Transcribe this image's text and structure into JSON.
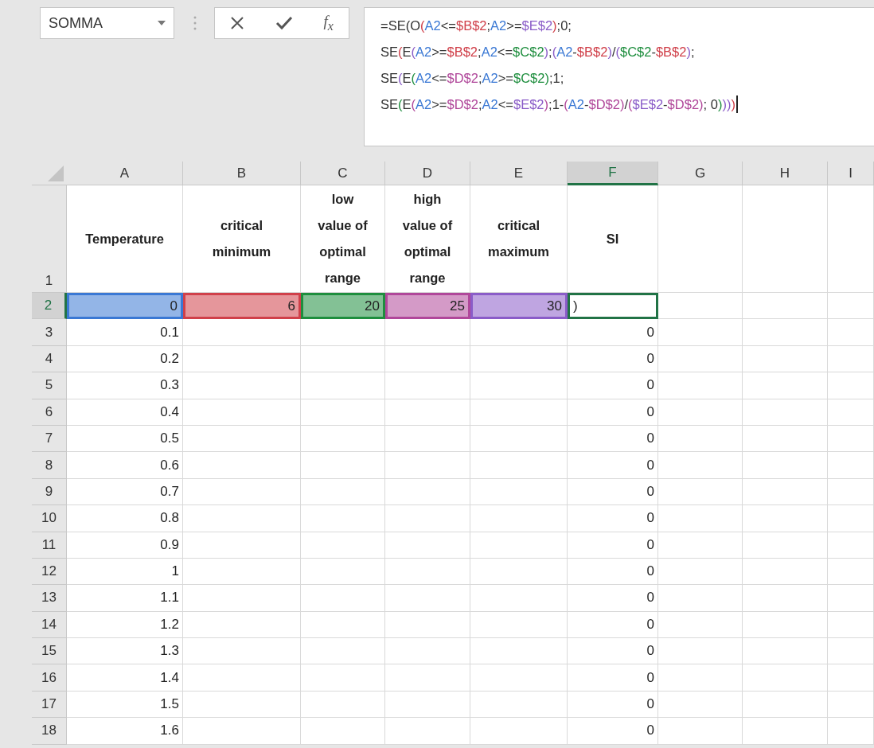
{
  "name_box": {
    "value": "SOMMA"
  },
  "formula_bar": {
    "function_label": "f$_{x}$",
    "lines": [
      {
        "caret": false,
        "segments": [
          {
            "text": "=SE(O"
          },
          {
            "text": "(",
            "color": "#d0404a"
          },
          {
            "text": "A2",
            "color": "#3a78d4"
          },
          {
            "text": "<="
          },
          {
            "text": "$B$2",
            "color": "#d0404a"
          },
          {
            "text": ";"
          },
          {
            "text": "A2",
            "color": "#3a78d4"
          },
          {
            "text": ">="
          },
          {
            "text": "$E$2",
            "color": "#8a5cc8"
          },
          {
            "text": ")",
            "color": "#d0404a"
          },
          {
            "text": ";0;"
          }
        ]
      },
      {
        "caret": false,
        "segments": [
          {
            "text": "SE"
          },
          {
            "text": "(",
            "color": "#d0404a"
          },
          {
            "text": "E"
          },
          {
            "text": "(",
            "color": "#8a5cc8"
          },
          {
            "text": "A2",
            "color": "#3a78d4"
          },
          {
            "text": ">="
          },
          {
            "text": "$B$2",
            "color": "#d0404a"
          },
          {
            "text": ";"
          },
          {
            "text": "A2",
            "color": "#3a78d4"
          },
          {
            "text": "<="
          },
          {
            "text": "$C$2",
            "color": "#1e8e3e"
          },
          {
            "text": ")",
            "color": "#8a5cc8"
          },
          {
            "text": ";"
          },
          {
            "text": "(",
            "color": "#8a5cc8"
          },
          {
            "text": "A2",
            "color": "#3a78d4"
          },
          {
            "text": "-"
          },
          {
            "text": "$B$2",
            "color": "#d0404a"
          },
          {
            "text": ")",
            "color": "#8a5cc8"
          },
          {
            "text": "/"
          },
          {
            "text": "(",
            "color": "#8a5cc8"
          },
          {
            "text": "$C$2",
            "color": "#1e8e3e"
          },
          {
            "text": "-"
          },
          {
            "text": "$B$2",
            "color": "#d0404a"
          },
          {
            "text": ")",
            "color": "#8a5cc8"
          },
          {
            "text": ";"
          }
        ]
      },
      {
        "caret": false,
        "segments": [
          {
            "text": "SE"
          },
          {
            "text": "(",
            "color": "#8a5cc8"
          },
          {
            "text": "E"
          },
          {
            "text": "(",
            "color": "#1e8e3e"
          },
          {
            "text": "A2",
            "color": "#3a78d4"
          },
          {
            "text": "<="
          },
          {
            "text": "$D$2",
            "color": "#b0479a"
          },
          {
            "text": ";"
          },
          {
            "text": "A2",
            "color": "#3a78d4"
          },
          {
            "text": ">="
          },
          {
            "text": "$C$2",
            "color": "#1e8e3e"
          },
          {
            "text": ")",
            "color": "#1e8e3e"
          },
          {
            "text": ";1;"
          }
        ]
      },
      {
        "caret": true,
        "segments": [
          {
            "text": "SE"
          },
          {
            "text": "(",
            "color": "#1e8e3e"
          },
          {
            "text": "E"
          },
          {
            "text": "(",
            "color": "#b0479a"
          },
          {
            "text": "A2",
            "color": "#3a78d4"
          },
          {
            "text": ">="
          },
          {
            "text": "$D$2",
            "color": "#b0479a"
          },
          {
            "text": ";"
          },
          {
            "text": "A2",
            "color": "#3a78d4"
          },
          {
            "text": "<="
          },
          {
            "text": "$E$2",
            "color": "#8a5cc8"
          },
          {
            "text": ")",
            "color": "#b0479a"
          },
          {
            "text": ";1-"
          },
          {
            "text": "(",
            "color": "#b0479a"
          },
          {
            "text": "A2",
            "color": "#3a78d4"
          },
          {
            "text": "-"
          },
          {
            "text": "$D$2",
            "color": "#b0479a"
          },
          {
            "text": ")",
            "color": "#b0479a"
          },
          {
            "text": "/"
          },
          {
            "text": "(",
            "color": "#b0479a"
          },
          {
            "text": "$E$2",
            "color": "#8a5cc8"
          },
          {
            "text": "-"
          },
          {
            "text": "$D$2",
            "color": "#b0479a"
          },
          {
            "text": ")",
            "color": "#b0479a"
          },
          {
            "text": "; 0"
          },
          {
            "text": ")",
            "color": "#1e8e3e"
          },
          {
            "text": ")",
            "color": "#8a5cc8"
          },
          {
            "text": ")",
            "color": "#8a5cc8"
          },
          {
            "text": ")",
            "color": "#d0404a"
          }
        ]
      }
    ]
  },
  "columns": [
    {
      "label": "A",
      "selected": false
    },
    {
      "label": "B",
      "selected": false
    },
    {
      "label": "C",
      "selected": false
    },
    {
      "label": "D",
      "selected": false
    },
    {
      "label": "E",
      "selected": false
    },
    {
      "label": "F",
      "selected": true
    },
    {
      "label": "G",
      "selected": false
    },
    {
      "label": "H",
      "selected": false
    },
    {
      "label": "I",
      "selected": false
    }
  ],
  "header_row": {
    "number": "1",
    "selected": false,
    "cells": [
      "Temperature",
      "critical minimum",
      "low value of optimal range",
      "high value of optimal range",
      "critical maximum",
      "SI"
    ]
  },
  "input_row": {
    "number": "2",
    "selected": true,
    "cells": [
      {
        "value": "0",
        "color": "#3a78d4",
        "selected": false
      },
      {
        "value": "6",
        "color": "#d0404a",
        "selected": false
      },
      {
        "value": "20",
        "color": "#1e8e3e",
        "selected": false
      },
      {
        "value": "25",
        "color": "#b0479a",
        "selected": false
      },
      {
        "value": "30",
        "color": "#8a5cc8",
        "selected": false
      },
      {
        "value": ")",
        "selected": true
      }
    ]
  },
  "rows": [
    {
      "number": "3",
      "selected": false,
      "temperature": "0.1",
      "si": "0"
    },
    {
      "number": "4",
      "selected": false,
      "temperature": "0.2",
      "si": "0"
    },
    {
      "number": "5",
      "selected": false,
      "temperature": "0.3",
      "si": "0"
    },
    {
      "number": "6",
      "selected": false,
      "temperature": "0.4",
      "si": "0"
    },
    {
      "number": "7",
      "selected": false,
      "temperature": "0.5",
      "si": "0"
    },
    {
      "number": "8",
      "selected": false,
      "temperature": "0.6",
      "si": "0"
    },
    {
      "number": "9",
      "selected": false,
      "temperature": "0.7",
      "si": "0"
    },
    {
      "number": "10",
      "selected": false,
      "temperature": "0.8",
      "si": "0"
    },
    {
      "number": "11",
      "selected": false,
      "temperature": "0.9",
      "si": "0"
    },
    {
      "number": "12",
      "selected": false,
      "temperature": "1",
      "si": "0"
    },
    {
      "number": "13",
      "selected": false,
      "temperature": "1.1",
      "si": "0"
    },
    {
      "number": "14",
      "selected": false,
      "temperature": "1.2",
      "si": "0"
    },
    {
      "number": "15",
      "selected": false,
      "temperature": "1.3",
      "si": "0"
    },
    {
      "number": "16",
      "selected": false,
      "temperature": "1.4",
      "si": "0"
    },
    {
      "number": "17",
      "selected": false,
      "temperature": "1.5",
      "si": "0"
    },
    {
      "number": "18",
      "selected": false,
      "temperature": "1.6",
      "si": "0"
    }
  ]
}
